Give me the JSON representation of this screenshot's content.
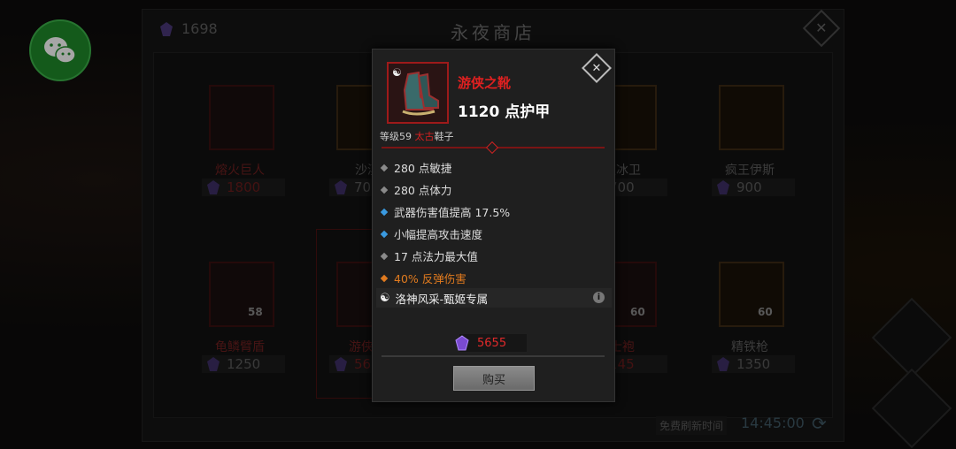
{
  "shop": {
    "title": "永夜商店",
    "currency_count": "1698",
    "refresh_label": "免费刷新时间",
    "refresh_time": "14:45:00",
    "items": [
      {
        "name": "熔火巨人",
        "price": "1800",
        "level": "",
        "price_red": true,
        "name_red": true
      },
      {
        "name": "沙漠",
        "price": "70",
        "level": "",
        "price_red": false,
        "name_red": false
      },
      {
        "name": "",
        "price": "",
        "level": "",
        "price_red": false,
        "name_red": false
      },
      {
        "name": "夜冰卫",
        "price": "700",
        "level": "",
        "price_red": false,
        "name_red": false
      },
      {
        "name": "疯王伊斯",
        "price": "900",
        "level": "",
        "price_red": false,
        "name_red": false
      },
      {
        "name": "龟鳞臂盾",
        "price": "1250",
        "level": "58",
        "price_red": false,
        "name_red": true
      },
      {
        "name": "游侠之",
        "price": "56",
        "level": "",
        "price_red": true,
        "name_red": true
      },
      {
        "name": "",
        "price": "",
        "level": "",
        "price_red": false,
        "name_red": false
      },
      {
        "name": "士袍",
        "price": "145",
        "level": "60",
        "price_red": true,
        "name_red": true
      },
      {
        "name": "精铁枪",
        "price": "1350",
        "level": "60",
        "price_red": false,
        "name_red": false
      }
    ]
  },
  "tooltip": {
    "item_name": "游侠之靴",
    "armor": "1120 点护甲",
    "grade_prefix": "等级59",
    "grade_quality": "太古",
    "grade_type": "鞋子",
    "stats": [
      {
        "text": "280 点敏捷",
        "bullet": "#8a8a8a",
        "orange": false
      },
      {
        "text": "280 点体力",
        "bullet": "#8a8a8a",
        "orange": false
      },
      {
        "text": "武器伤害值提高 17.5%",
        "bullet": "#3a9ae0",
        "orange": false
      },
      {
        "text": "小幅提高攻击速度",
        "bullet": "#3a9ae0",
        "orange": false
      },
      {
        "text": "17 点法力最大值",
        "bullet": "#8a8a8a",
        "orange": false
      },
      {
        "text": "40% 反弹伤害",
        "bullet": "#e07a1f",
        "orange": true
      }
    ],
    "set_name": "洛神风采-甄姬专属",
    "price": "5655",
    "buy_label": "购买"
  },
  "colors": {
    "accent_red": "#e02020",
    "gem_purple": "#7a4ad0",
    "orange": "#e07a1f",
    "blue": "#3a9ae0"
  }
}
